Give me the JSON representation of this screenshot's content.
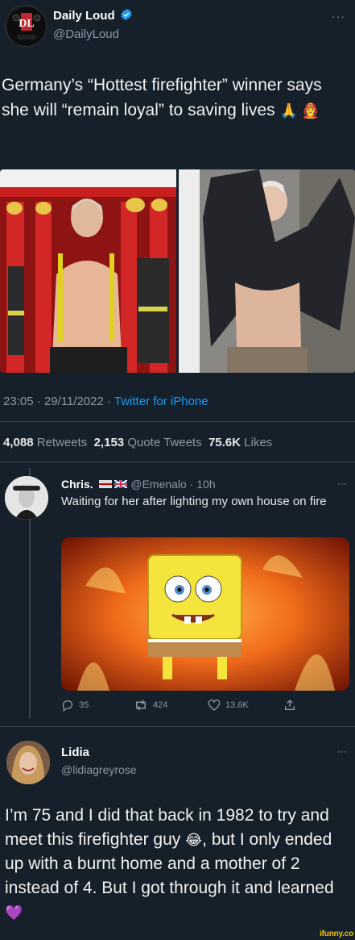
{
  "main_tweet": {
    "name": "Daily Loud",
    "handle": "@DailyLoud",
    "avatar_text": "DL",
    "menu": "···",
    "text": "Germany’s “Hottest firefighter” winner says she will “remain loyal” to saving lives",
    "emojis": "🙏 👩‍🚒",
    "time": "23:05 · 29/11/2022 · ",
    "source": "Twitter for iPhone",
    "stats": {
      "retweets_count": "4,088",
      "retweets_label": "Retweets",
      "quotes_count": "2,153",
      "quotes_label": "Quote Tweets",
      "likes_count": "75.6K",
      "likes_label": "Likes"
    }
  },
  "reply_1": {
    "name": "Chris.",
    "handle_time": "@Emenalo · 10h",
    "menu": "···",
    "text": "Waiting for her after lighting my own house on fire",
    "actions": {
      "reply_count": "35",
      "retweet_count": "424",
      "like_count": "13.6K"
    }
  },
  "reply_2": {
    "name": "Lidia",
    "handle": "@lidiagreyrose",
    "menu": "···",
    "text_part1": "I’m 75 and I did that back in 1982 to try and meet this firefighter guy ",
    "text_part2": ", but I only ended up with a burnt home and a mother of 2 instead of 4. But I got through it and learned ",
    "emoji_1": "😂",
    "emoji_2": "💜"
  },
  "watermark": "ifunny.co",
  "colors": {
    "background": "#15202b",
    "link": "#1d9bf0",
    "verified": "#1d9bf0",
    "muted": "#8b98a5"
  }
}
